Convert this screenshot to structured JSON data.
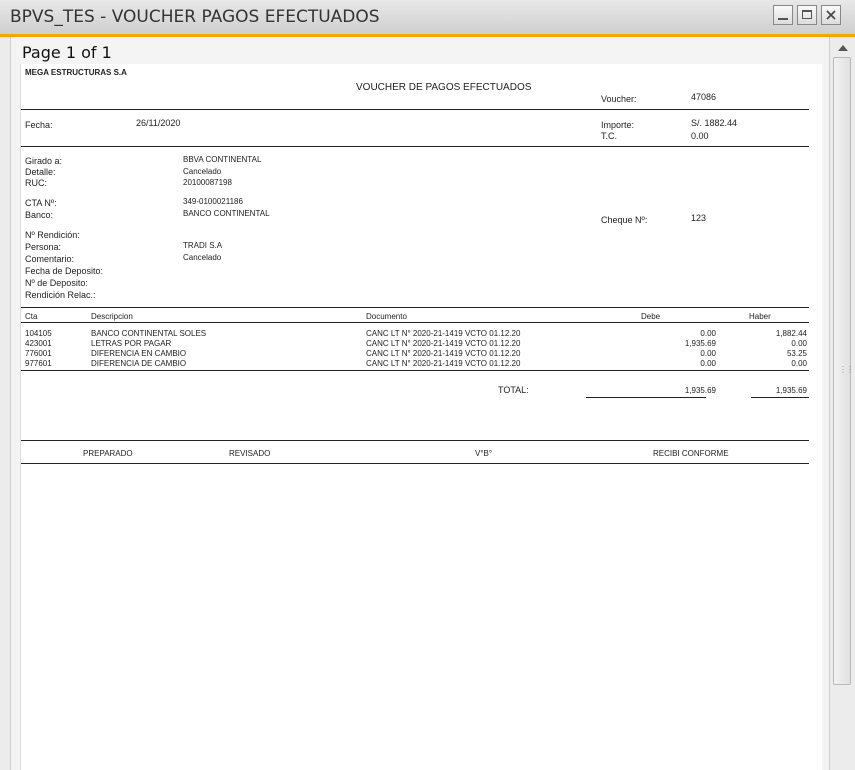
{
  "window": {
    "title": "BPVS_TES - VOUCHER PAGOS EFECTUADOS"
  },
  "viewer": {
    "page_label": "Page 1 of 1"
  },
  "voucher": {
    "company": "MEGA ESTRUCTURAS S.A",
    "title": "VOUCHER DE PAGOS EFECTUADOS",
    "voucher_label": "Voucher:",
    "voucher_value": "47086",
    "fecha_label": "Fecha:",
    "fecha_value": "26/11/2020",
    "importe_label": "Importe:",
    "importe_value": "S/. 1882.44",
    "tc_label": "T.C.",
    "tc_value": "0.00",
    "girado_label": "Girado a:",
    "girado_value": "BBVA CONTINENTAL",
    "detalle_label": "Detalle:",
    "detalle_value": "Cancelado",
    "ruc_label": "RUC:",
    "ruc_value": "20100087198",
    "cta_label": "CTA Nº:",
    "cta_value": "349-0100021186",
    "banco_label": "Banco:",
    "banco_value": "BANCO CONTINENTAL",
    "cheque_label": "Cheque Nº:",
    "cheque_value": "123",
    "rendicion_label": "Nº Rendición:",
    "persona_label": "Persona:",
    "persona_value": "TRADI S.A",
    "comentario_label": "Comentario:",
    "comentario_value": "Cancelado",
    "fecha_deposito_label": "Fecha de Deposito:",
    "nro_deposito_label": "Nº de Deposito:",
    "rendicion_relac_label": "Rendición Relac.:"
  },
  "table": {
    "headers": {
      "cta": "Cta",
      "descripcion": "Descripcion",
      "documento": "Documento",
      "debe": "Debe",
      "haber": "Haber"
    },
    "rows": [
      {
        "cta": "104105",
        "descripcion": "BANCO CONTINENTAL SOLES",
        "documento": "CANC LT N° 2020-21-1419 VCTO 01.12.20",
        "debe": "0.00",
        "haber": "1,882.44"
      },
      {
        "cta": "423001",
        "descripcion": "LETRAS POR PAGAR",
        "documento": "CANC LT N° 2020-21-1419 VCTO 01.12.20",
        "debe": "1,935.69",
        "haber": "0.00"
      },
      {
        "cta": "776001",
        "descripcion": "DIFERENCIA EN CAMBIO",
        "documento": "CANC LT N° 2020-21-1419 VCTO 01.12.20",
        "debe": "0.00",
        "haber": "53.25"
      },
      {
        "cta": "977601",
        "descripcion": "DIFERENCIA DE CAMBIO",
        "documento": "CANC LT N° 2020-21-1419 VCTO 01.12.20",
        "debe": "0.00",
        "haber": "0.00"
      }
    ],
    "total_label": "TOTAL:",
    "total_debe": "1,935.69",
    "total_haber": "1,935.69"
  },
  "signatures": {
    "preparado": "PREPARADO",
    "revisado": "REVISADO",
    "vb": "V°B°",
    "recibi": "RECIBI CONFORME"
  },
  "icons": {
    "minimize": "minimize-icon",
    "maximize": "maximize-icon",
    "close": "close-icon",
    "scroll_up": "arrow-up-icon"
  },
  "colors": {
    "title_accent": "#f0a800"
  }
}
